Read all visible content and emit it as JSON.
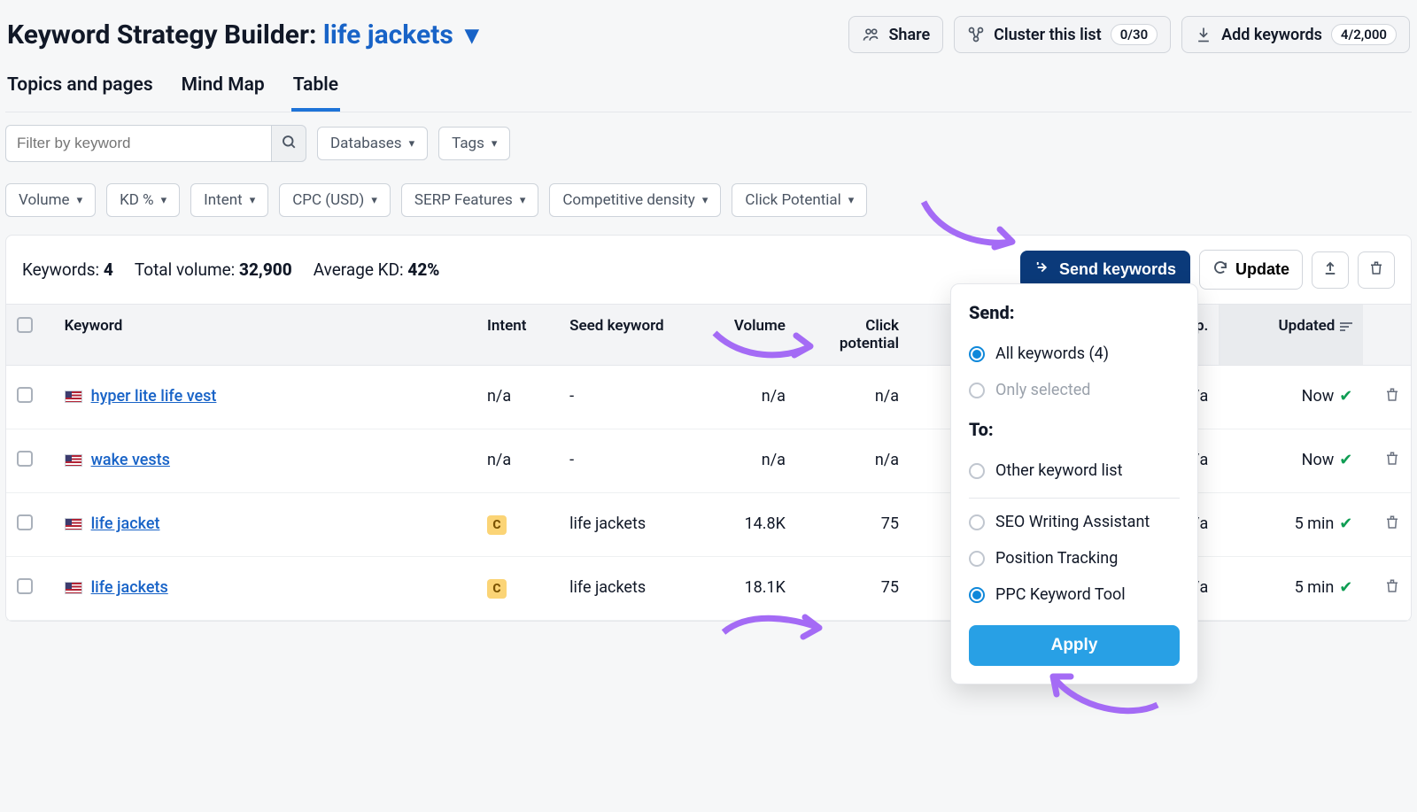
{
  "header": {
    "title_prefix": "Keyword Strategy Builder:",
    "topic": "life jackets",
    "share_label": "Share",
    "cluster_label": "Cluster this list",
    "cluster_badge": "0/30",
    "add_label": "Add keywords",
    "add_badge": "4/2,000"
  },
  "tabs": {
    "t0": "Topics and pages",
    "t1": "Mind Map",
    "t2": "Table"
  },
  "filters": {
    "placeholder": "Filter by keyword",
    "databases": "Databases",
    "tags": "Tags",
    "volume": "Volume",
    "kd": "KD %",
    "intent": "Intent",
    "cpc": "CPC (USD)",
    "serp": "SERP Features",
    "density": "Competitive density",
    "clickpot": "Click Potential"
  },
  "summary": {
    "keywords_label": "Keywords:",
    "keywords_val": "4",
    "volume_label": "Total volume:",
    "volume_val": "32,900",
    "kd_label": "Average KD:",
    "kd_val": "42%"
  },
  "actions": {
    "send": "Send keywords",
    "update": "Update"
  },
  "columns": {
    "keyword": "Keyword",
    "intent": "Intent",
    "seed": "Seed keyword",
    "volume": "Volume",
    "clickpot": "Click potential",
    "topcomp": "Top Comp.",
    "updated": "Updated"
  },
  "rows": [
    {
      "keyword": "hyper lite life vest",
      "intent": "n/a",
      "seed": "-",
      "volume": "n/a",
      "clickpot": "n/a",
      "topcomp": "n/a",
      "updated": "Now"
    },
    {
      "keyword": "wake vests",
      "intent": "n/a",
      "seed": "-",
      "volume": "n/a",
      "clickpot": "n/a",
      "topcomp": "n/a",
      "updated": "Now"
    },
    {
      "keyword": "life jacket",
      "intent": "C",
      "seed": "life jackets",
      "volume": "14.8K",
      "clickpot": "75",
      "topcomp": "n/a",
      "updated": "5 min"
    },
    {
      "keyword": "life jackets",
      "intent": "C",
      "seed": "life jackets",
      "volume": "18.1K",
      "clickpot": "75",
      "topcomp": "n/a",
      "updated": "5 min"
    }
  ],
  "popup": {
    "send_title": "Send:",
    "all": "All keywords (4)",
    "only": "Only selected",
    "to_title": "To:",
    "other": "Other keyword list",
    "swa": "SEO Writing Assistant",
    "pt": "Position Tracking",
    "ppc": "PPC Keyword Tool",
    "apply": "Apply"
  }
}
